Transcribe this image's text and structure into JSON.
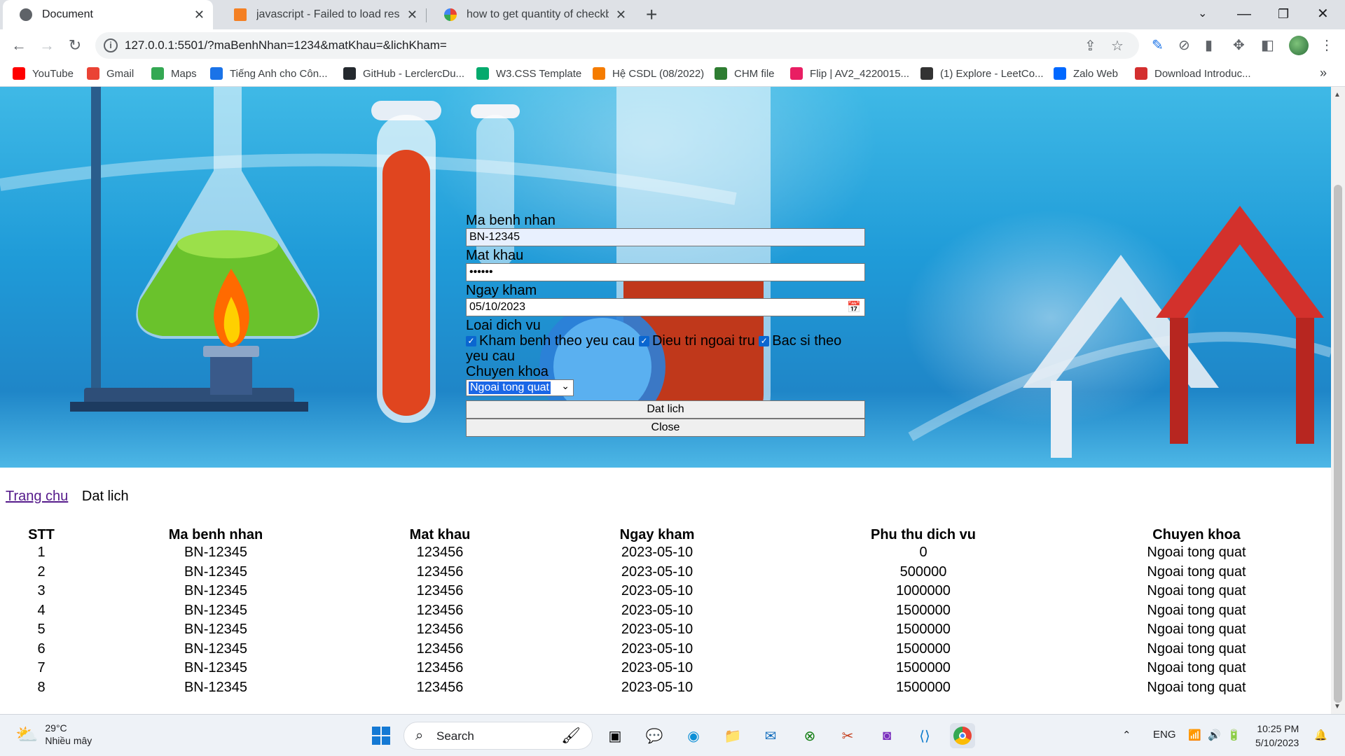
{
  "browser": {
    "tabs": [
      {
        "title": "Document",
        "active": true
      },
      {
        "title": "javascript - Failed to load resource",
        "active": false
      },
      {
        "title": "how to get quantity of checkbox",
        "active": false
      }
    ],
    "url": "127.0.0.1:5501/?maBenhNhan=1234&matKhau=&lichKham=",
    "bookmarks": [
      {
        "label": "YouTube",
        "color": "#ff0000"
      },
      {
        "label": "Gmail",
        "color": "#ea4335"
      },
      {
        "label": "Maps",
        "color": "#34a853"
      },
      {
        "label": "Tiếng Anh cho Côn...",
        "color": "#1a73e8"
      },
      {
        "label": "GitHub - LerclercDu...",
        "color": "#24292e"
      },
      {
        "label": "W3.CSS Template",
        "color": "#04aa6d"
      },
      {
        "label": "Hệ CSDL (08/2022)",
        "color": "#f57c00"
      },
      {
        "label": "CHM file",
        "color": "#2e7d32"
      },
      {
        "label": "Flip | AV2_4220015...",
        "color": "#e91e63"
      },
      {
        "label": "(1) Explore - LeetCo...",
        "color": "#333333"
      },
      {
        "label": "Zalo Web",
        "color": "#0068ff"
      },
      {
        "label": "Download Introduc...",
        "color": "#d32f2f"
      }
    ]
  },
  "form": {
    "patient_id_label": "Ma benh nhan",
    "patient_id_value": "BN-12345",
    "password_label": "Mat khau",
    "password_value": "••••••",
    "date_label": "Ngay kham",
    "date_value": "05/10/2023",
    "service_label": "Loai dich vu",
    "services": [
      "Kham benh theo yeu cau",
      "Dieu tri ngoai tru",
      "Bac si theo yeu cau"
    ],
    "specialty_label": "Chuyen khoa",
    "specialty_value": "Ngoai tong quat",
    "submit_label": "Dat lich",
    "close_label": "Close"
  },
  "breadcrumb": {
    "home": "Trang chu",
    "current": "Dat lich"
  },
  "table": {
    "headers": [
      "STT",
      "Ma benh nhan",
      "Mat khau",
      "Ngay kham",
      "Phu thu dich vu",
      "Chuyen khoa"
    ],
    "rows": [
      [
        "1",
        "BN-12345",
        "123456",
        "2023-05-10",
        "0",
        "Ngoai tong quat"
      ],
      [
        "2",
        "BN-12345",
        "123456",
        "2023-05-10",
        "500000",
        "Ngoai tong quat"
      ],
      [
        "3",
        "BN-12345",
        "123456",
        "2023-05-10",
        "1000000",
        "Ngoai tong quat"
      ],
      [
        "4",
        "BN-12345",
        "123456",
        "2023-05-10",
        "1500000",
        "Ngoai tong quat"
      ],
      [
        "5",
        "BN-12345",
        "123456",
        "2023-05-10",
        "1500000",
        "Ngoai tong quat"
      ],
      [
        "6",
        "BN-12345",
        "123456",
        "2023-05-10",
        "1500000",
        "Ngoai tong quat"
      ],
      [
        "7",
        "BN-12345",
        "123456",
        "2023-05-10",
        "1500000",
        "Ngoai tong quat"
      ],
      [
        "8",
        "BN-12345",
        "123456",
        "2023-05-10",
        "1500000",
        "Ngoai tong quat"
      ]
    ]
  },
  "taskbar": {
    "weather_temp": "29°C",
    "weather_desc": "Nhiều mây",
    "search_label": "Search",
    "language": "ENG",
    "time": "10:25 PM",
    "date": "5/10/2023"
  }
}
